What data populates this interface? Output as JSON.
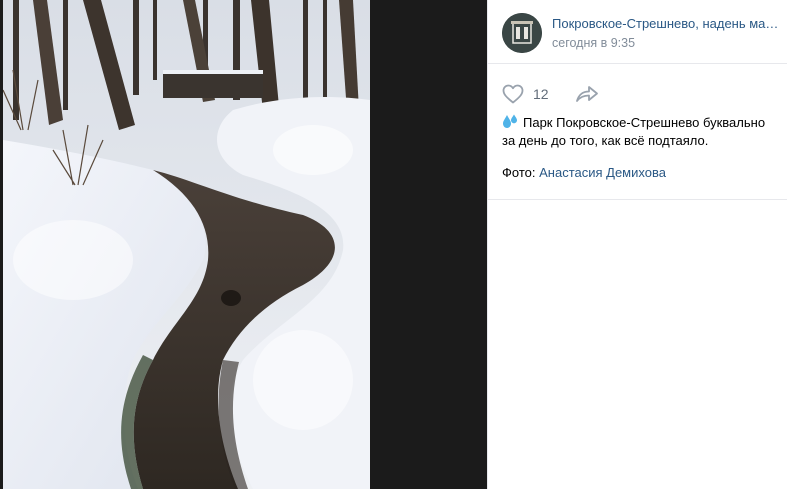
{
  "post": {
    "group_name": "Покровское-Стрешнево, надень маску",
    "time": "сегодня в 9:35",
    "likes": "12",
    "text": "Парк Покровское-Стрешнево буквально за день до того, как всё подтаяло.",
    "credit_label": "Фото:",
    "credit_author": "Анастасия Демихова"
  },
  "icons": {
    "like": "heart-icon",
    "share": "share-arrow-icon",
    "emoji": "sweat-droplets-icon"
  },
  "colors": {
    "link": "#2a5885",
    "secondary": "#818c99",
    "viewer_bg": "#1b1b1b"
  }
}
